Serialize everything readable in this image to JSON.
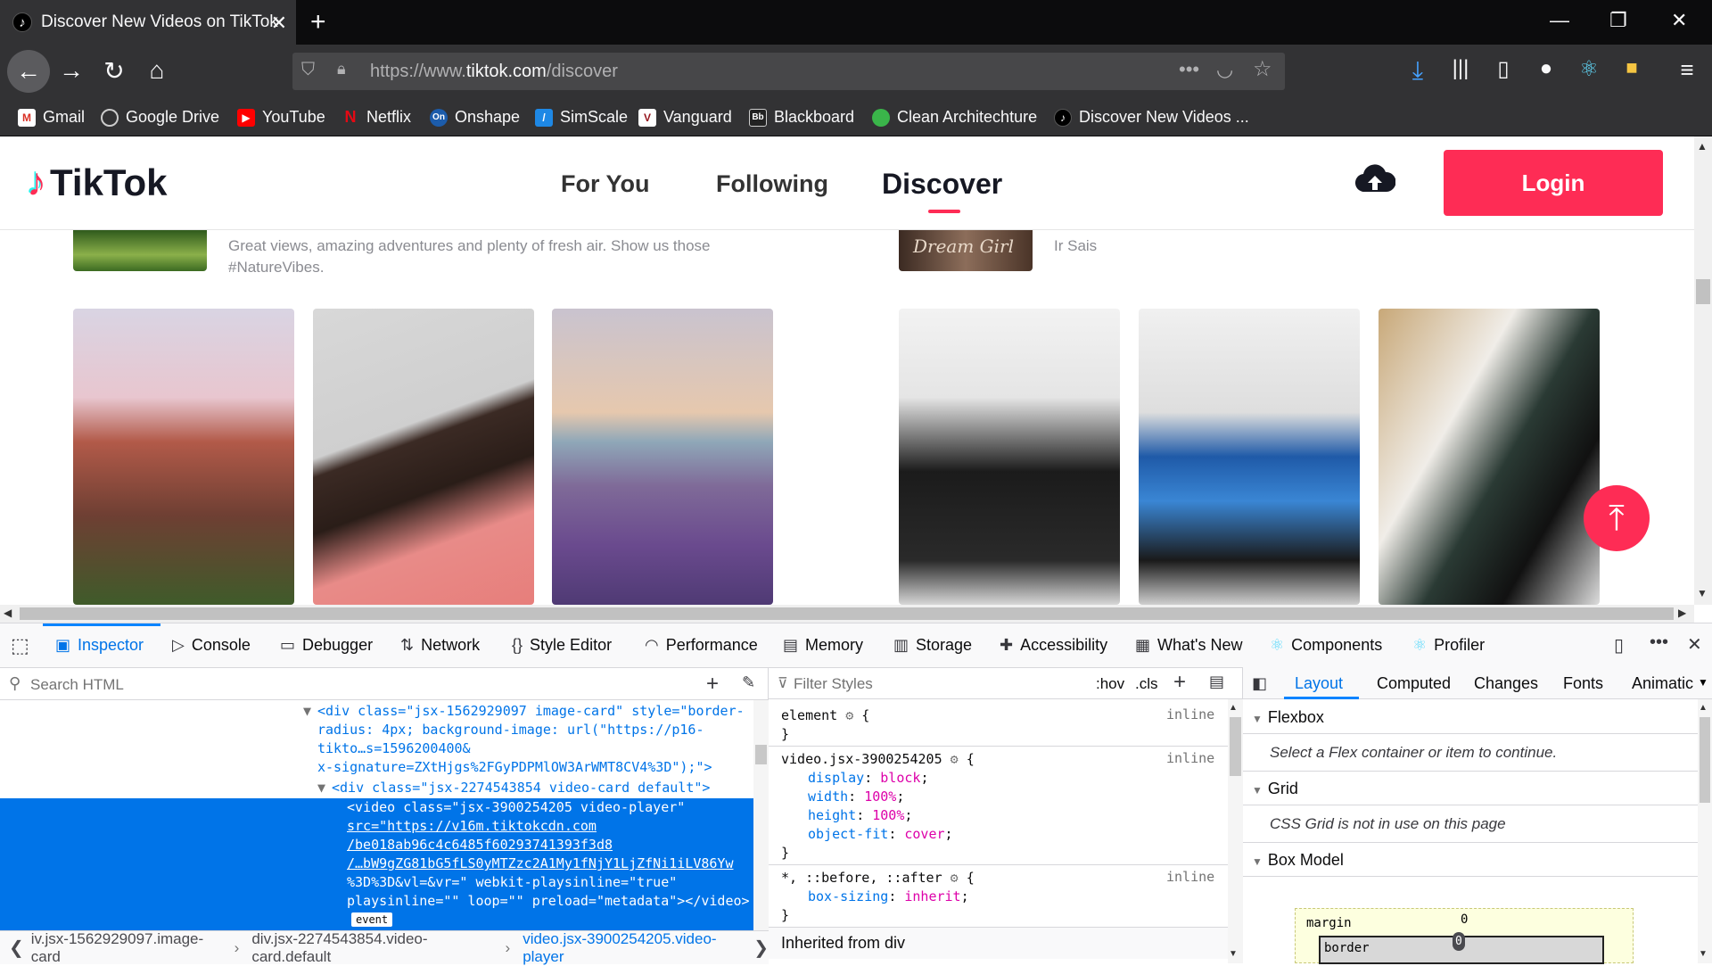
{
  "browser": {
    "tab_title": "Discover New Videos on TikTok",
    "url_prefix": "https://www.",
    "url_domain": "tiktok.com",
    "url_path": "/discover",
    "bookmarks": [
      "Gmail",
      "Google Drive",
      "YouTube",
      "Netflix",
      "Onshape",
      "SimScale",
      "Vanguard",
      "Blackboard",
      "Clean Architechture",
      "Discover New Videos ..."
    ]
  },
  "tiktok": {
    "logo": "TikTok",
    "nav": [
      "For You",
      "Following",
      "Discover"
    ],
    "login": "Login",
    "hashtag_desc_left": "Great views, amazing adventures and plenty of fresh air. Show us those #NatureVibes.",
    "music_label_right": "Ir Sais",
    "music_cover_text": "Dream Girl"
  },
  "devtools": {
    "tabs": [
      "Inspector",
      "Console",
      "Debugger",
      "Network",
      "Style Editor",
      "Performance",
      "Memory",
      "Storage",
      "Accessibility",
      "What's New",
      "Components",
      "Profiler"
    ],
    "search_placeholder": "Search HTML",
    "filter_placeholder": "Filter Styles",
    "hov": ":hov",
    "cls": ".cls",
    "markup_lines": [
      "<div class=\"jsx-1562929097 image-card\" style=\"border-",
      "radius: 4px; background-image: url(\"https://p16-",
      "tikto…s=1596200400&",
      "x-signature=ZXtHjgs%2FGyPDPMlOW3ArWMT8CV4%3D\");\">",
      "<div class=\"jsx-2274543854 video-card default\">"
    ],
    "selected_lines": [
      "<video class=\"jsx-3900254205 video-player\"",
      "src=\"https://v16m.tiktokcdn.com",
      "/be018ab96c4c6485f60293741393f3d8",
      "/…bW9gZG81bG5fLS0yMTZzc2A1My1fNjY1LjZfNi1iLV86Yw",
      "%3D%3D&vl=&vr=\" webkit-playsinline=\"true\"",
      "playsinline=\"\" loop=\"\" preload=\"metadata\"></video>"
    ],
    "event_badge": "event",
    "breadcrumbs": [
      "iv.jsx-1562929097.image-card",
      "div.jsx-2274543854.video-card.default",
      "video.jsx-3900254205.video-player"
    ],
    "rules": {
      "element": "element",
      "inline": "inline",
      "video_selector": "video.jsx-3900254205",
      "props": [
        [
          "display",
          "block"
        ],
        [
          "width",
          "100%"
        ],
        [
          "height",
          "100%"
        ],
        [
          "object-fit",
          "cover"
        ]
      ],
      "universal_selector": "*, ::before, ::after",
      "universal_prop": [
        "box-sizing",
        "inherit"
      ],
      "inherited": "Inherited from div"
    },
    "layout_tabs": [
      "Layout",
      "Computed",
      "Changes",
      "Fonts",
      "Animatic"
    ],
    "flexbox_title": "Flexbox",
    "flexbox_msg": "Select a Flex container or item to continue.",
    "grid_title": "Grid",
    "grid_msg": "CSS Grid is not in use on this page",
    "boxmodel_title": "Box Model",
    "margin_label": "margin",
    "border_label": "border",
    "zero": "0"
  },
  "colors": {
    "tiktok_red": "#fe2c55",
    "devtools_blue": "#0074e8"
  }
}
